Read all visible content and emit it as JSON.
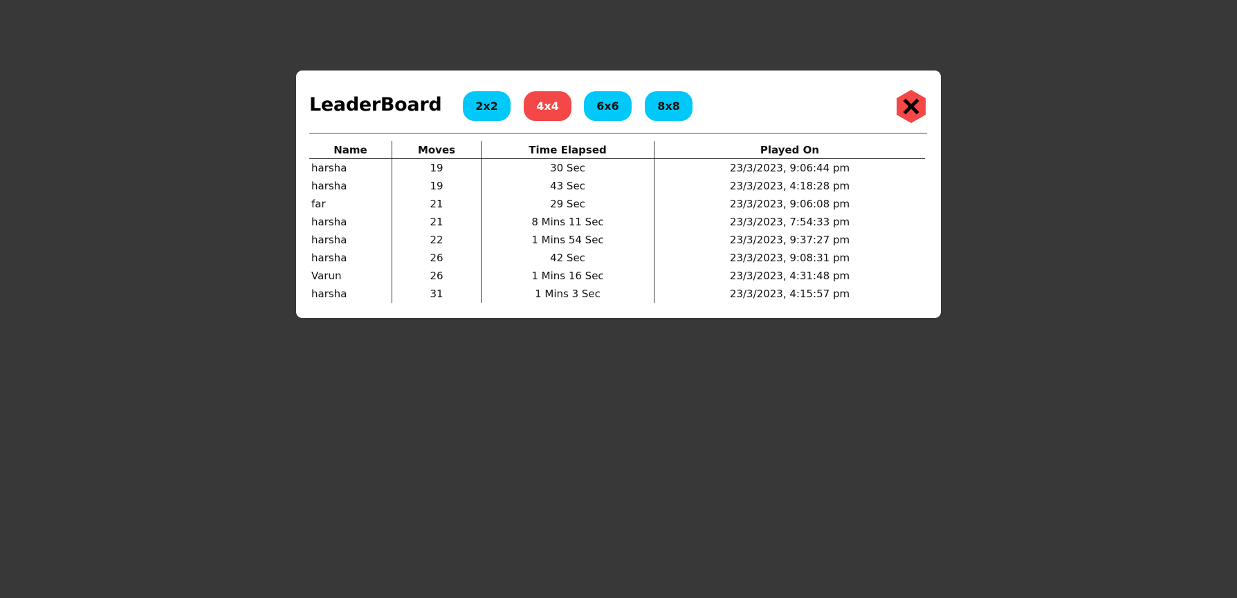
{
  "modal": {
    "title": "LeaderBoard",
    "size_buttons": [
      {
        "label": "2x2",
        "active": false
      },
      {
        "label": "4x4",
        "active": true
      },
      {
        "label": "6x6",
        "active": false
      },
      {
        "label": "8x8",
        "active": false
      }
    ],
    "close_icon": "close-x-icon",
    "colors": {
      "background": "#383838",
      "active_button": "#f44747",
      "inactive_button": "#00c8f8",
      "close_button": "#f44747"
    }
  },
  "table": {
    "columns": [
      "Name",
      "Moves",
      "Time Elapsed",
      "Played On"
    ],
    "rows": [
      {
        "name": "harsha",
        "moves": "19",
        "time": "30 Sec",
        "played_on": "23/3/2023, 9:06:44 pm"
      },
      {
        "name": "harsha",
        "moves": "19",
        "time": "43 Sec",
        "played_on": "23/3/2023, 4:18:28 pm"
      },
      {
        "name": "far",
        "moves": "21",
        "time": "29 Sec",
        "played_on": "23/3/2023, 9:06:08 pm"
      },
      {
        "name": "harsha",
        "moves": "21",
        "time": "8 Mins 11 Sec",
        "played_on": "23/3/2023, 7:54:33 pm"
      },
      {
        "name": "harsha",
        "moves": "22",
        "time": "1 Mins 54 Sec",
        "played_on": "23/3/2023, 9:37:27 pm"
      },
      {
        "name": "harsha",
        "moves": "26",
        "time": "42 Sec",
        "played_on": "23/3/2023, 9:08:31 pm"
      },
      {
        "name": "Varun",
        "moves": "26",
        "time": "1 Mins 16 Sec",
        "played_on": "23/3/2023, 4:31:48 pm"
      },
      {
        "name": "harsha",
        "moves": "31",
        "time": "1 Mins 3 Sec",
        "played_on": "23/3/2023, 4:15:57 pm"
      }
    ]
  }
}
